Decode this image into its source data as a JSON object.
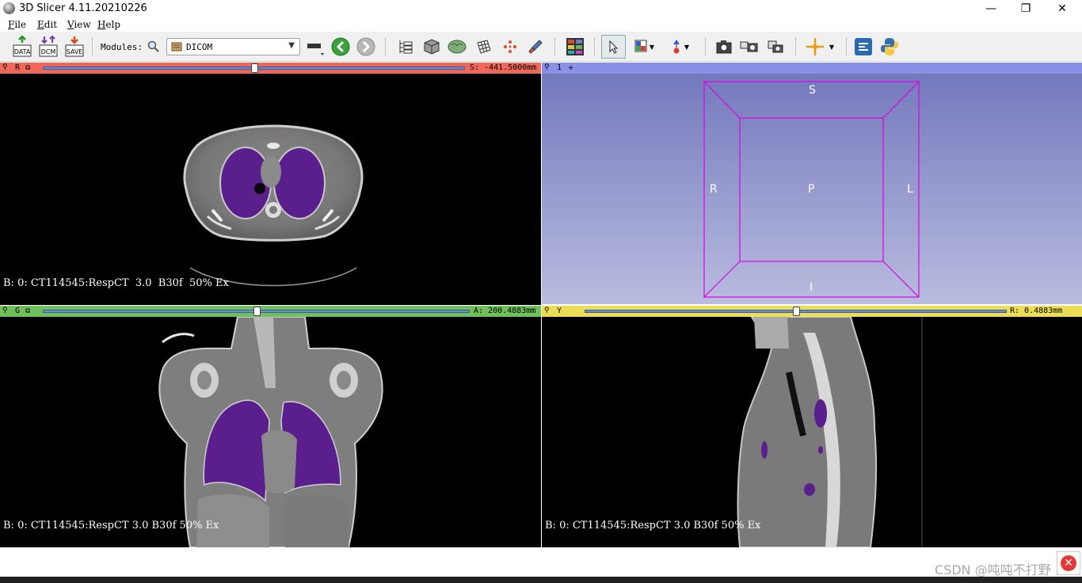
{
  "window": {
    "title": "3D Slicer 4.11.20210226",
    "minimize": "—",
    "restore": "❐",
    "close": "✕"
  },
  "menu": [
    "File",
    "Edit",
    "View",
    "Help"
  ],
  "toolbar": {
    "data_label": "DATA",
    "dcm_label": "DCM",
    "save_label": "SAVE",
    "modules_label": "Modules:",
    "module_selected": "DICOM"
  },
  "views": {
    "red": {
      "letter": "R",
      "offset": "S: -441.5000mm",
      "color": "#f0685a",
      "slider_position": 0.5,
      "corner_text": "B: 0: CT114545:RespCT  3.0  B30f  50% Ex"
    },
    "three_d": {
      "number": "1",
      "orient_top": "S",
      "orient_bottom": "I",
      "orient_left": "R",
      "orient_right": "L",
      "orient_center": "P"
    },
    "green": {
      "letter": "G",
      "offset": "A: 200.4883mm",
      "color": "#6fbf5b",
      "slider_position": 0.5,
      "corner_text": "B: 0: CT114545:RespCT  3.0  B30f  50% Ex"
    },
    "yellow": {
      "letter": "Y",
      "offset": "R: 0.4883mm",
      "color": "#ebdd56",
      "slider_position": 0.5,
      "corner_text": "B: 0: CT114545:RespCT  3.0  B30f  50% Ex"
    }
  },
  "watermark": "CSDN @吨吨不打野",
  "colors": {
    "segmentation": "#5a1f8c",
    "bounding_box": "#e000e0"
  }
}
